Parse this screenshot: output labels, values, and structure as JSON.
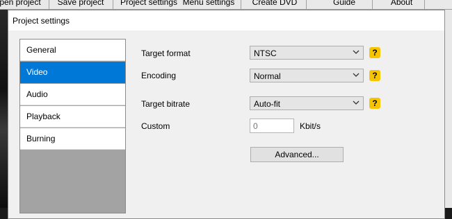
{
  "app_menu": {
    "tabs": [
      "pen project",
      "Save project",
      "Project settings",
      "Menu settings",
      "Create DVD",
      "Guide",
      "About"
    ]
  },
  "dialog": {
    "title": "Project settings"
  },
  "sidebar": {
    "items": [
      {
        "label": "General",
        "active": false
      },
      {
        "label": "Video",
        "active": true
      },
      {
        "label": "Audio",
        "active": false
      },
      {
        "label": "Playback",
        "active": false
      },
      {
        "label": "Burning",
        "active": false
      }
    ]
  },
  "form": {
    "target_format": {
      "label": "Target format",
      "value": "NTSC"
    },
    "encoding": {
      "label": "Encoding",
      "value": "Normal"
    },
    "target_bitrate": {
      "label": "Target bitrate",
      "value": "Auto-fit"
    },
    "custom": {
      "label": "Custom",
      "placeholder": "0",
      "unit": "Kbit/s"
    },
    "advanced_button": "Advanced...",
    "help_glyph": "?"
  },
  "colors": {
    "accent": "#0078d7",
    "help_badge": "#f6c400"
  }
}
